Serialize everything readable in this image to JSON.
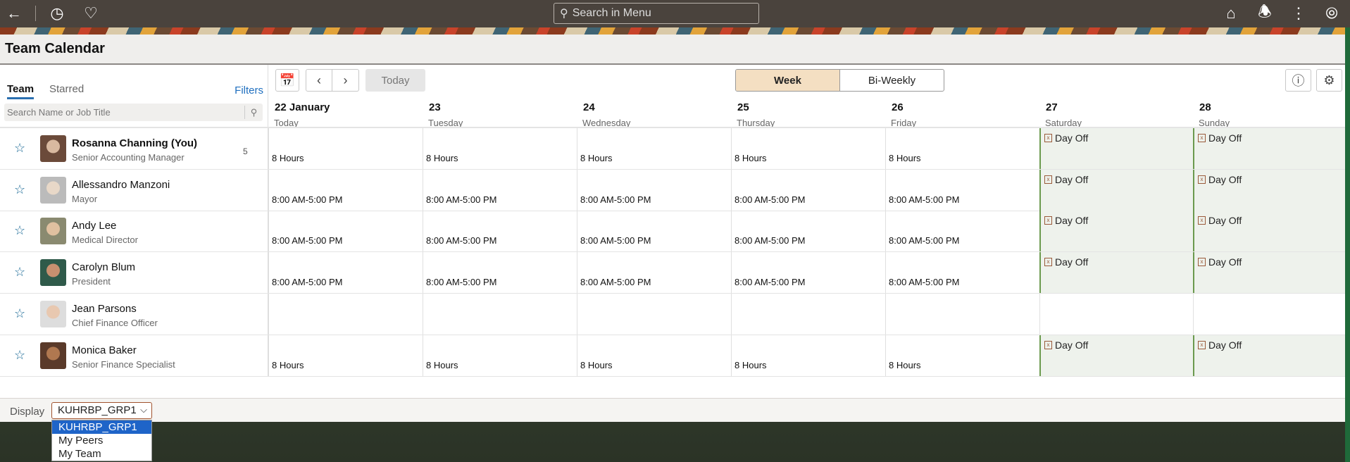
{
  "topbar": {
    "search_placeholder": "Search in Menu"
  },
  "page": {
    "title": "Team Calendar"
  },
  "left": {
    "tabs": [
      "Team",
      "Starred"
    ],
    "filters": "Filters",
    "search_placeholder": "Search Name or Job Title"
  },
  "toolbar": {
    "today": "Today",
    "views": [
      "Week",
      "Bi-Weekly"
    ],
    "active_view": "Week"
  },
  "days": [
    {
      "num": "22 January",
      "name": "Today"
    },
    {
      "num": "23",
      "name": "Tuesday"
    },
    {
      "num": "24",
      "name": "Wednesday"
    },
    {
      "num": "25",
      "name": "Thursday"
    },
    {
      "num": "26",
      "name": "Friday"
    },
    {
      "num": "27",
      "name": "Saturday"
    },
    {
      "num": "28",
      "name": "Sunday"
    }
  ],
  "rows": [
    {
      "name": "Rosanna Channing (You)",
      "title": "Senior Accounting Manager",
      "badge": "5",
      "bold": true,
      "cells": [
        "8 Hours",
        "8 Hours",
        "8 Hours",
        "8 Hours",
        "8 Hours",
        "Day Off",
        "Day Off"
      ]
    },
    {
      "name": "Allessandro Manzoni",
      "title": "Mayor",
      "cells": [
        "8:00 AM-5:00 PM",
        "8:00 AM-5:00 PM",
        "8:00 AM-5:00 PM",
        "8:00 AM-5:00 PM",
        "8:00 AM-5:00 PM",
        "Day Off",
        "Day Off"
      ]
    },
    {
      "name": "Andy Lee",
      "title": "Medical Director",
      "cells": [
        "8:00 AM-5:00 PM",
        "8:00 AM-5:00 PM",
        "8:00 AM-5:00 PM",
        "8:00 AM-5:00 PM",
        "8:00 AM-5:00 PM",
        "Day Off",
        "Day Off"
      ]
    },
    {
      "name": "Carolyn Blum",
      "title": "President",
      "cells": [
        "8:00 AM-5:00 PM",
        "8:00 AM-5:00 PM",
        "8:00 AM-5:00 PM",
        "8:00 AM-5:00 PM",
        "8:00 AM-5:00 PM",
        "Day Off",
        "Day Off"
      ]
    },
    {
      "name": "Jean Parsons",
      "title": "Chief Finance Officer",
      "cells": [
        "",
        "",
        "",
        "",
        "",
        "",
        ""
      ]
    },
    {
      "name": "Monica Baker",
      "title": "Senior Finance Specialist",
      "cells": [
        "8 Hours",
        "8 Hours",
        "8 Hours",
        "8 Hours",
        "8 Hours",
        "Day Off",
        "Day Off"
      ]
    }
  ],
  "footer": {
    "label": "Display",
    "selected": "KUHRBP_GRP1",
    "options": [
      "KUHRBP_GRP1",
      "My Peers",
      "My Team"
    ]
  },
  "colors": {
    "accent": "#1f6fbf",
    "week_active": "#f4dfc2",
    "dayoff_bg": "#eef2ec",
    "dayoff_border": "#6b9a4e"
  }
}
